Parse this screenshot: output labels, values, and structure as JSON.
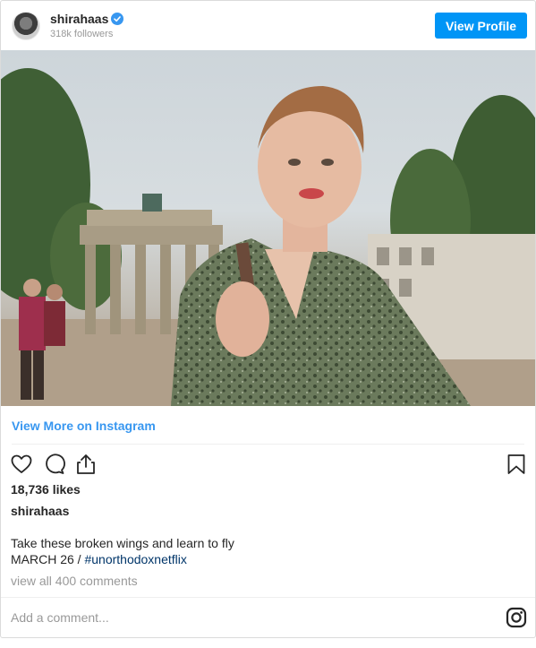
{
  "header": {
    "username": "shirahaas",
    "followers": "318k followers",
    "view_profile_label": "View Profile"
  },
  "post": {
    "view_more_label": "View More on Instagram",
    "likes": "18,736 likes",
    "caption_user": "shirahaas",
    "caption_text": "Take these broken wings and learn to fly",
    "caption_date": "MARCH 26 / ",
    "hashtag": "#unorthodoxnetflix",
    "view_comments": "view all 400 comments",
    "add_comment_placeholder": "Add a comment..."
  },
  "colors": {
    "accent": "#3897f0",
    "button": "#0095f6",
    "hashtag": "#003569",
    "muted": "#999999"
  },
  "icons": [
    "heart-icon",
    "comment-icon",
    "share-icon",
    "bookmark-icon",
    "instagram-logo-icon",
    "verified-badge-icon"
  ]
}
